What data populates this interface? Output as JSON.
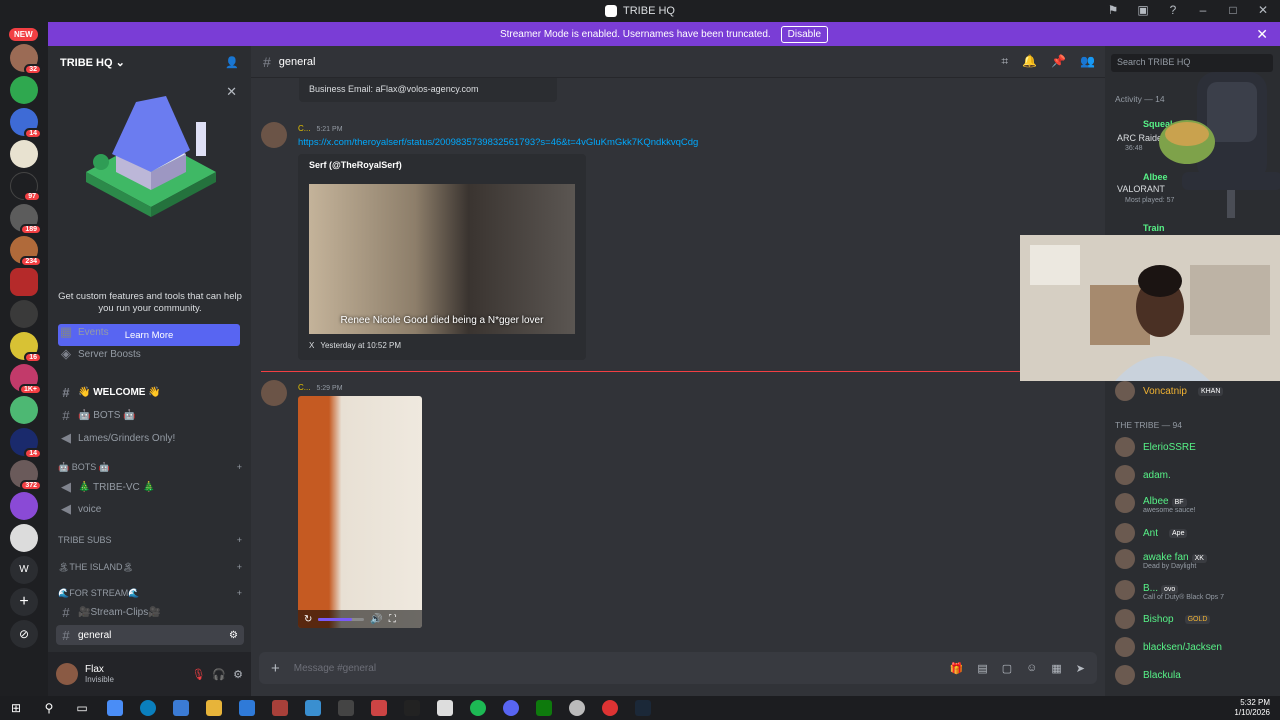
{
  "window": {
    "title": "TRIBE HQ"
  },
  "streamer_bar": {
    "text": "Streamer Mode is enabled. Usernames have been truncated.",
    "button": "Disable"
  },
  "guilds": {
    "new_label": "NEW",
    "badges": [
      "32",
      "14",
      "97",
      "189",
      "234",
      "16",
      "1K+",
      "14",
      "372"
    ]
  },
  "server": {
    "name": "TRIBE HQ"
  },
  "promo": {
    "text": "Get custom features and tools that can help you run your community.",
    "button": "Learn More"
  },
  "channels": {
    "events": "Events",
    "boosts": "Server Boosts",
    "welcome": "👋 WELCOME 👋",
    "bots": "🤖 BOTS 🤖",
    "lames": "Lames/Grinders Only!",
    "cat_bots": "🤖 BOTS 🤖",
    "tribe_vc": "🎄 TRIBE-VC 🎄",
    "voice": "voice",
    "cat_subs": "TRIBE SUBS",
    "cat_island": "🏝THE ISLAND🏝",
    "cat_stream": "🌊FOR STREAM🌊",
    "stream_clips": "🎥Stream-Clips🎥",
    "general": "general"
  },
  "user": {
    "name": "Flax",
    "status": "Invisible"
  },
  "channel_header": {
    "name": "general"
  },
  "messages": {
    "embed_top_text": "Business Email: aFlax@volos-agency.com",
    "m1_name": "C...",
    "m1_time": "5:21 PM",
    "m1_link": "https://x.com/theroyalserf/status/2009835739832561793?s=46&t=4vGluKmGkk7KQndkkvqCdg",
    "embed_author": "Serf (@TheRoyalSerf)",
    "embed_caption": "Renee Nicole Good died being a N*gger lover",
    "embed_footer": "Yesterday at 10:52 PM",
    "embed_footer_icon": "X",
    "m2_name": "C...",
    "m2_time": "5:29 PM",
    "video_progress": 0.72
  },
  "composer": {
    "placeholder": "Message #general"
  },
  "members": {
    "search_placeholder": "Search TRIBE HQ",
    "activity_header": "Activity — 14",
    "activities": [
      {
        "name": "Squeal",
        "game": "ARC Raide",
        "sub": "36:48"
      },
      {
        "name": "Albee",
        "game": "VALORANT",
        "sub": "Most played: 57"
      },
      {
        "name": "Train",
        "game": "",
        "sub": ""
      }
    ],
    "voncatnip": "Voncatnip",
    "voncatnip_tag": "KHAN",
    "tribe_header": "THE TRIBE — 94",
    "list": [
      {
        "name": "ElerioSSRE",
        "tag": "",
        "sub": ""
      },
      {
        "name": "adam.",
        "tag": "",
        "sub": ""
      },
      {
        "name": "Albee",
        "tag": "BF",
        "sub": "awesome sauce!"
      },
      {
        "name": "Ant",
        "tag": "Ape",
        "sub": ""
      },
      {
        "name": "awake fan",
        "tag": "XK",
        "sub": "Dead by Daylight"
      },
      {
        "name": "B...",
        "tag": "ovo",
        "sub": "Call of Duty® Black Ops 7"
      },
      {
        "name": "Bishop",
        "tag": "GOLD",
        "sub": ""
      },
      {
        "name": "blacksen/Jacksen",
        "tag": "",
        "sub": ""
      },
      {
        "name": "Blackula",
        "tag": "",
        "sub": ""
      }
    ]
  },
  "taskbar": {
    "time": "5:32 PM",
    "date": "1/10/2026"
  },
  "colors": {
    "accent": "#5865f2",
    "streamer": "#7a3dd6",
    "online": "#57f287",
    "link": "#00a8fc"
  }
}
